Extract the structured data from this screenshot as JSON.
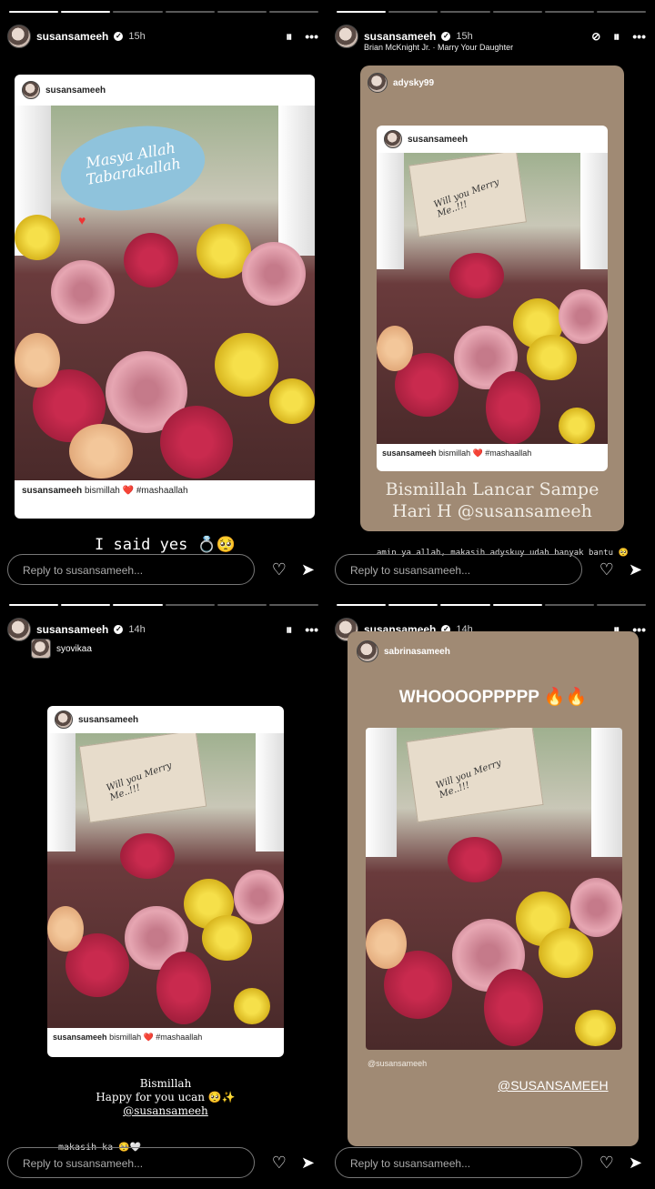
{
  "panels": [
    {
      "user": "susansameeh",
      "time": "15h",
      "card_user": "susansameeh",
      "sticker": "Masya Allah Tabarakallah",
      "caption_user": "susansameeh",
      "caption_text": "bismillah ❤️ #mashaallah",
      "overlay": "I said yes 💍🥺",
      "reply_placeholder": "Reply to susansameeh..."
    },
    {
      "user": "susansameeh",
      "time": "15h",
      "music": "Brian McKnight Jr. · Marry Your Daughter",
      "shared_by": "adysky99",
      "card_user": "susansameeh",
      "sign": "Will you Merry Me..!!!",
      "caption_user": "susansameeh",
      "caption_text": "bismillah ❤️ #mashaallah",
      "overlay_line1": "Bismillah Lancar Sampe",
      "overlay_line2": "Hari H @susansameeh",
      "reply_text": "amin ya allah, makasih adyskuy udah banyak bantu 🥺",
      "reply_placeholder": "Reply to susansameeh..."
    },
    {
      "user": "susansameeh",
      "time": "14h",
      "shared_by": "syovikaa",
      "card_user": "susansameeh",
      "sign": "Will you Merry Me..!!!",
      "caption_user": "susansameeh",
      "caption_text": "bismillah ❤️ #mashaallah",
      "overlay_line1": "Bismillah",
      "overlay_line2": "Happy for you ucan 🥺✨",
      "overlay_line3": "@susansameeh",
      "reply_text": "makasih ka 🥺🤍",
      "reply_placeholder": "Reply to susansameeh..."
    },
    {
      "user": "susansameeh",
      "time": "14h",
      "shared_by": "sabrinasameeh",
      "headline": "WHOOOOPPPPP 🔥🔥",
      "sign": "Will you Merry Me..!!!",
      "mention_small": "@susansameeh",
      "mention_big": "@SUSANSAMEEH",
      "reply_placeholder": "Reply to susansameeh..."
    }
  ],
  "icons": {
    "verified": "✓",
    "pause": "⏸",
    "more": "•••",
    "mute": "🔇",
    "heart": "♡",
    "send": "➤"
  }
}
